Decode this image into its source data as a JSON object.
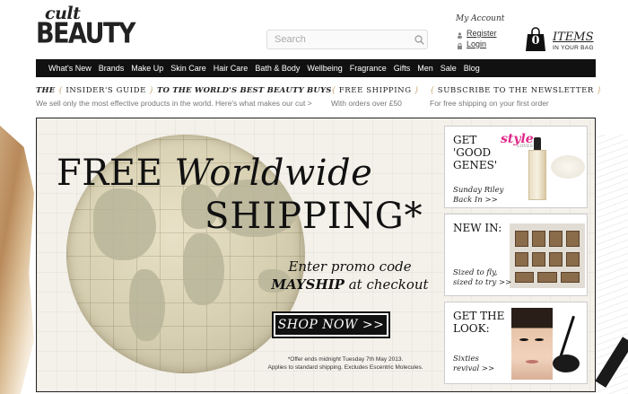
{
  "logo": {
    "line1": "cult",
    "line2": "BEAUTY"
  },
  "search": {
    "placeholder": "Search"
  },
  "account": {
    "title": "My Account",
    "register": "Register",
    "login": "Login"
  },
  "bag": {
    "count": "0",
    "items_label": "ITEMS",
    "sub_label": "IN YOUR BAG"
  },
  "nav": [
    "What's New",
    "Brands",
    "Make Up",
    "Skin Care",
    "Hair Care",
    "Bath & Body",
    "Wellbeing",
    "Fragrance",
    "Gifts",
    "Men",
    "Sale",
    "Blog"
  ],
  "info": {
    "guide": {
      "pre": "THE",
      "bracket_open": "{",
      "keyword": "INSIDER'S GUIDE",
      "bracket_close": "}",
      "post": "TO THE WORLD'S BEST BEAUTY BUYS",
      "sub": "We sell only the most effective products in the world. Here's what makes our cut >"
    },
    "shipping": {
      "bracket_open": "{",
      "title": "FREE SHIPPING",
      "bracket_close": "}",
      "sub": "With orders over £50"
    },
    "newsletter": {
      "bracket_open": "{",
      "title": "SUBSCRIBE TO THE NEWSLETTER",
      "bracket_close": "}",
      "sub": "For free shipping on your first order"
    }
  },
  "banner": {
    "headline_1a": "FREE",
    "headline_1b": "Worldwide",
    "headline_2": "SHIPPING*",
    "promo_line1": "Enter promo code",
    "promo_code": "MAYSHIP",
    "promo_line2": "at checkout",
    "cta": "SHOP NOW >>",
    "fine_print_1": "*Offer ends midnight Tuesday 7th May 2013.",
    "fine_print_2": "Applies to standard shipping. Excludes Escentric Molecules."
  },
  "promos": [
    {
      "title": "GET\n'GOOD\nGENES'",
      "sub": "Sunday Riley\nBack In >>",
      "badge": "style",
      "badge_sub": "LOVES"
    },
    {
      "title": "NEW IN:",
      "sub": "Sized to fly,\nsized to try >>"
    },
    {
      "title": "GET THE\nLOOK:",
      "sub": "Sixties\nrevival >>"
    }
  ],
  "colors": {
    "nav_bg": "#111111",
    "accent_gold": "#c8a878",
    "style_pink": "#e0288a"
  }
}
